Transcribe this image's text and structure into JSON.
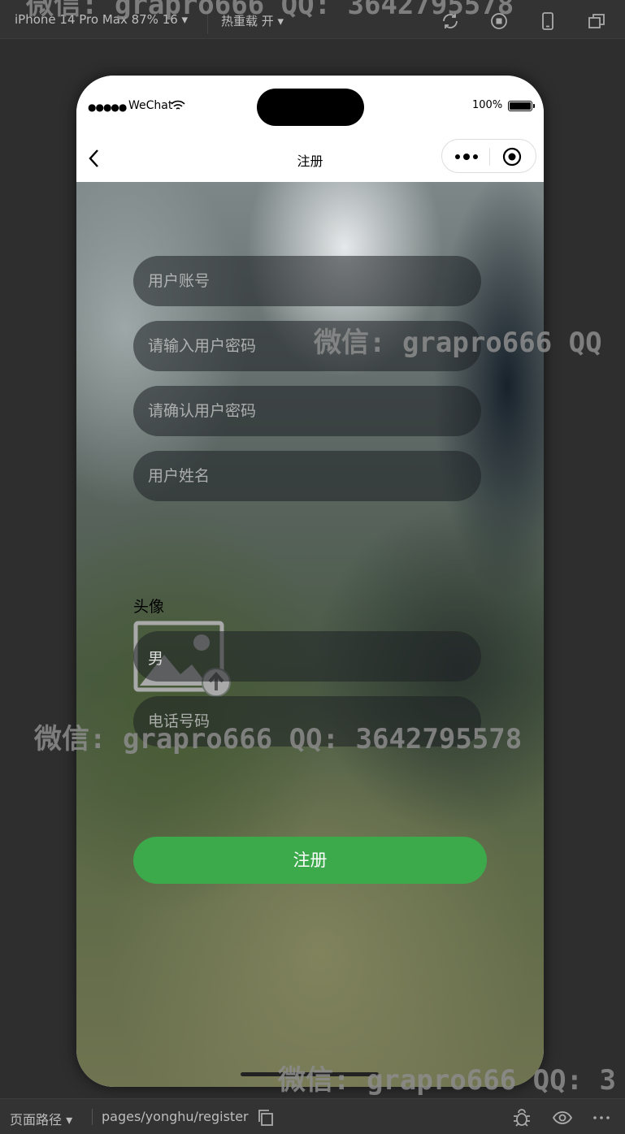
{
  "devtools": {
    "device_label": "iPhone 14 Pro Max 87% 16 ▾",
    "hot_reload_label": "热重载 开 ▾",
    "page_path_label": "页面路径 ▾",
    "page_path": "pages/yonghu/register"
  },
  "watermark": {
    "text": "微信: grapro666 QQ: 3642795578",
    "text_partial_right": "微信: grapro666 QQ",
    "text_partial_bottom": "微信: grapro666 QQ: 3"
  },
  "status_bar": {
    "signal_dots": "●●●●●",
    "carrier": "WeChat",
    "battery_percent": "100%"
  },
  "nav": {
    "title": "注册"
  },
  "form": {
    "account_placeholder": "用户账号",
    "password_placeholder": "请输入用户密码",
    "confirm_password_placeholder": "请确认用户密码",
    "name_placeholder": "用户姓名",
    "avatar_label": "头像",
    "gender_value": "男",
    "phone_placeholder": "电话号码",
    "submit_label": "注册"
  },
  "colors": {
    "submit_button": "#3ca94b",
    "devtools_bg": "#333333"
  }
}
